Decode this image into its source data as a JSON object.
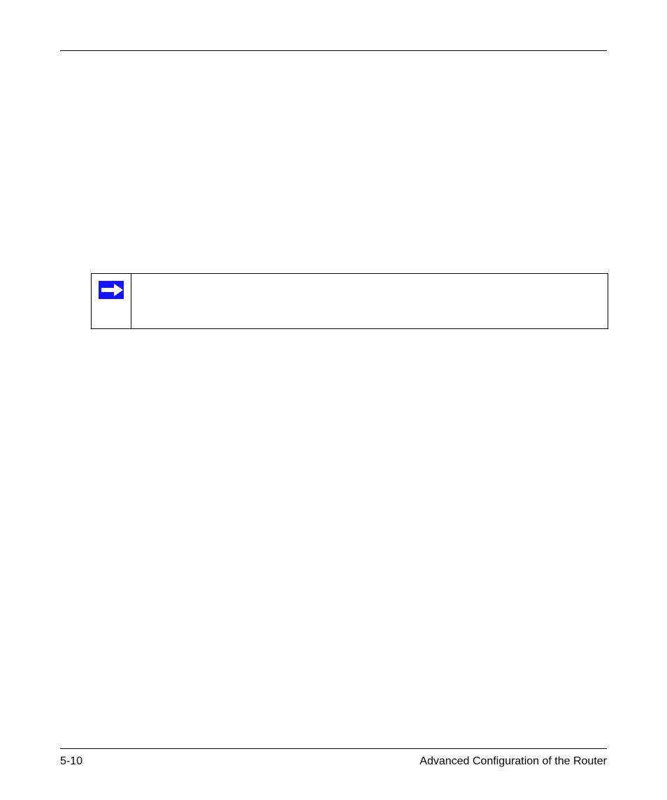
{
  "note": {
    "text": ""
  },
  "footer": {
    "page_number": "5-10",
    "section_title": "Advanced Configuration of the Router"
  }
}
